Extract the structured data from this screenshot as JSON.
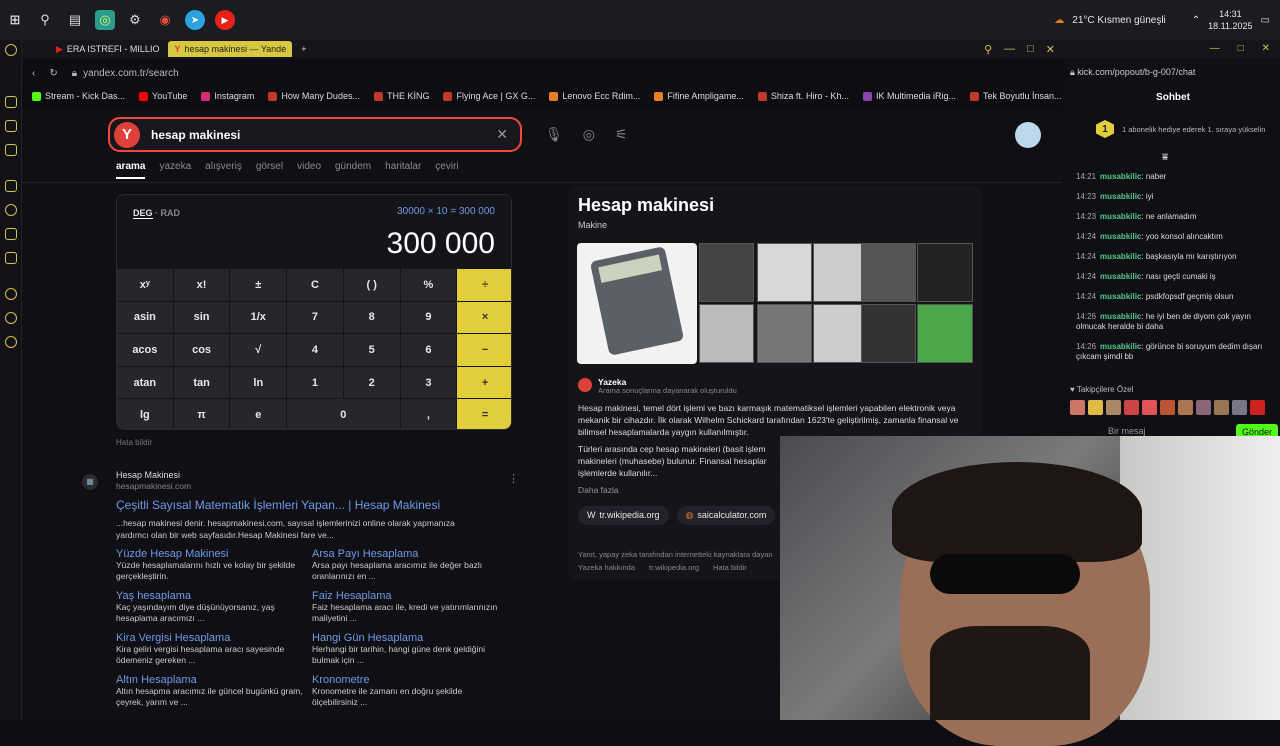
{
  "taskbar": {
    "weather": "21°C  Kısmen güneşli",
    "time": "14:31",
    "date": "18.11.2025"
  },
  "tabs": [
    {
      "label": "ERA ISTREFI - MILLIO"
    },
    {
      "label": "hesap makinesi — Yande"
    }
  ],
  "address": "yandex.com.tr/search",
  "bookmarks": [
    {
      "label": "Stream - Kick Das...",
      "color": "#53fc18"
    },
    {
      "label": "YouTube",
      "color": "#ff0000"
    },
    {
      "label": "Instagram",
      "color": "#d62976"
    },
    {
      "label": "How Many Dudes...",
      "color": "#c0392b"
    },
    {
      "label": "THE KİNG",
      "color": "#c0392b"
    },
    {
      "label": "Flying Ace | GX G...",
      "color": "#c0392b"
    },
    {
      "label": "Lenovo Ecc Rdim...",
      "color": "#e67e22"
    },
    {
      "label": "Fifine Ampligame...",
      "color": "#e67e22"
    },
    {
      "label": "Shiza ft. Hiro - Kh...",
      "color": "#c0392b"
    },
    {
      "label": "IK Multimedia iRig...",
      "color": "#8e44ad"
    },
    {
      "label": "Tek Boyutlu İnsan...",
      "color": "#c0392b"
    }
  ],
  "search": {
    "query": "hesap makinesi"
  },
  "navtabs": [
    "arama",
    "yazeka",
    "alışveriş",
    "görsel",
    "video",
    "gündem",
    "haritalar",
    "çeviri"
  ],
  "calc": {
    "deg": "DEG",
    "rad": "RAD",
    "expression": "30000 × 10 = 300 000",
    "result": "300 000",
    "keys": [
      [
        "xʸ",
        "x!",
        "±",
        "C",
        "( )",
        "%",
        "÷"
      ],
      [
        "asin",
        "sin",
        "1/x",
        "7",
        "8",
        "9",
        "×"
      ],
      [
        "acos",
        "cos",
        "√",
        "4",
        "5",
        "6",
        "−"
      ],
      [
        "atan",
        "tan",
        "ln",
        "1",
        "2",
        "3",
        "+"
      ],
      [
        "lg",
        "π",
        "e",
        "0",
        ",",
        "="
      ]
    ],
    "report": "Hata bildir"
  },
  "result": {
    "site": "Hesap Makinesi",
    "url": "hesapmakinesi.com",
    "title": "Çeşitli Sayısal Matematik İşlemleri Yapan... | Hesap Makinesi",
    "snippet": "...hesap makinesi denir. hesapmakinesi.com, sayısal işlemlerinizi online olarak yapmanıza yardımcı olan bir web sayfasıdır.Hesap Makinesi fare ve...",
    "links": [
      {
        "title": "Yüzde Hesap Makinesi",
        "desc": "Yüzde hesaplamalarını hızlı ve kolay bir şekilde gerçekleştirin."
      },
      {
        "title": "Arsa Payı Hesaplama",
        "desc": "Arsa payı hesaplama aracımız ile değer bazlı oranlarınızı en ..."
      },
      {
        "title": "Yaş hesaplama",
        "desc": "Kaç yaşındayım diye düşünüyorsanız, yaş hesaplama aracımızı ..."
      },
      {
        "title": "Faiz Hesaplama",
        "desc": "Faiz hesaplama aracı ile, kredi ve yatırımlarınızın maliyetini ..."
      },
      {
        "title": "Kira Vergisi Hesaplama",
        "desc": "Kira geliri vergisi hesaplama aracı sayesinde ödemeniz gereken ..."
      },
      {
        "title": "Hangi Gün Hesaplama",
        "desc": "Herhangi bir tarihin, hangi güne denk geldiğini bulmak için ..."
      },
      {
        "title": "Altın Hesaplama",
        "desc": "Altın hesapma aracımız ile güncel bugünkü gram, çeyrek, yarım ve ..."
      },
      {
        "title": "Kronometre",
        "desc": "Kronometre ile zamanı en doğru şekilde ölçebilirsiniz ..."
      }
    ]
  },
  "knowledge": {
    "title": "Hesap makinesi",
    "subtitle": "Makine",
    "source": "Yazeka",
    "source_note": "Arama sonuçlarına dayanarak oluşturuldu",
    "para1": "Hesap makinesi, temel dört işlemi ve bazı karmaşık matematiksel işlemleri yapabilen elektronik veya mekanik bir cihazdır. İlk olarak Wilhelm Schickard tarafından 1623'te geliştirilmiş, zamanla finansal ve bilimsel hesaplamalarda yaygın kullanılmıştır.",
    "para2": "Türleri arasında cep hesap makineleri (basit işlem makineleri (muhasebe) bulunur. Finansal hesaplar işlemlerde kullanılır...",
    "more": "Daha fazla",
    "chips": [
      "tr.wikipedia.org",
      "saicalculator.com"
    ],
    "footer": "Yanıt, yapay zeka tarafından internetteki kaynaklara dayan",
    "footer_links": [
      "Yazeka hakkında",
      "tr.wikipedia.org",
      "Hata bildir"
    ]
  },
  "chat": {
    "url": "kick.com/popout/b-g-007/chat",
    "title": "Sohbet",
    "pinned": "1 abonelik hediye ederek 1. sıraya yükselin",
    "messages": [
      {
        "time": "14:21",
        "user": "musabkilic",
        "text": "naber"
      },
      {
        "time": "14:23",
        "user": "musabkilic",
        "text": "iyi"
      },
      {
        "time": "14:23",
        "user": "musabkilic",
        "text": "ne anlamadım"
      },
      {
        "time": "14:24",
        "user": "musabkilic",
        "text": "yoo konsol alıncaktım"
      },
      {
        "time": "14:24",
        "user": "musabkilic",
        "text": "başkasıyla mı karıştırıyon"
      },
      {
        "time": "14:24",
        "user": "musabkilic",
        "text": "nası geçti cumaki iş"
      },
      {
        "time": "14:24",
        "user": "musabkilic",
        "text": "psdkfopsdf geçmiş olsun"
      },
      {
        "time": "14:26",
        "user": "musabkilic",
        "text": "he iyi ben de diyom çok yayın olmucak heralde bi daha"
      },
      {
        "time": "14:26",
        "user": "musabkilic",
        "text": "görünce bi soruyum dedim dışarı çıkcam şimdi bb"
      }
    ],
    "followers": "Takipçilere Özel",
    "input_placeholder": "Bir mesaj",
    "send": "Gönder"
  }
}
